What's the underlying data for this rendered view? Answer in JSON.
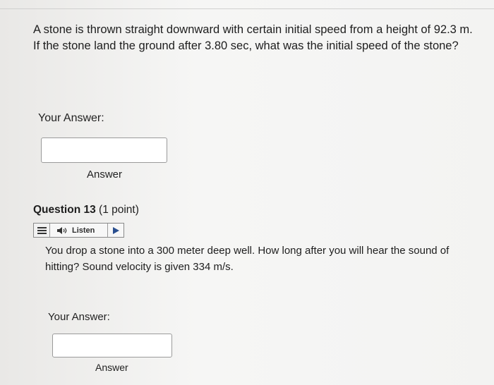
{
  "question12": {
    "prompt": "A stone is thrown straight downward with certain initial speed from a height of 92.3 m. If the stone land the ground after 3.80 sec, what was the initial speed of the stone?",
    "your_answer_label": "Your Answer:",
    "answer_value": "",
    "answer_caption": "Answer"
  },
  "question13": {
    "title": "Question 13",
    "points": "(1 point)",
    "listen_label": "Listen",
    "prompt": "You drop a stone into a 300 meter deep well. How long after you will hear the sound of hitting? Sound velocity is given 334 m/s.",
    "your_answer_label": "Your Answer:",
    "answer_value": "",
    "answer_caption": "Answer"
  },
  "icons": {
    "menu": "menu-icon",
    "speaker": "speaker-icon",
    "play": "play-icon"
  },
  "colors": {
    "text": "#1e1e1e",
    "box_border": "#9a9a9a",
    "background": "#f3f3f2"
  }
}
